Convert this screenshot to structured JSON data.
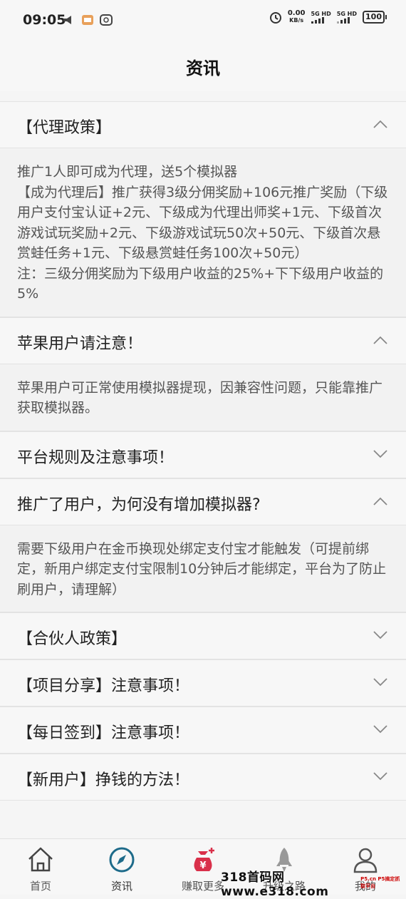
{
  "status_bar": {
    "time": "09:05",
    "net_speed_value": "0.00",
    "net_speed_unit": "KB/s",
    "sim1": "5G HD",
    "sim2": "5G HD",
    "battery": "100"
  },
  "header": {
    "title": "资讯"
  },
  "sections": [
    {
      "title": "【代理政策】",
      "expanded": true,
      "body": [
        "推广1人即可成为代理，送5个模拟器",
        "【成为代理后】推广获得3级分佣奖励+106元推广奖励（下级用户支付宝认证+2元、下级成为代理出师奖+1元、下级首次游戏试玩奖励+2元、下级游戏试玩50次+50元、下级首次悬赏蛙任务+1元、下级悬赏蛙任务100次+50元）",
        "注：三级分佣奖励为下级用户收益的25%+下下级用户收益的5%"
      ]
    },
    {
      "title": "苹果用户请注意！",
      "expanded": true,
      "body": [
        "苹果用户可正常使用模拟器提现，因兼容性问题，只能靠推广获取模拟器。"
      ]
    },
    {
      "title": "平台规则及注意事项！",
      "expanded": false
    },
    {
      "title": "推广了用户，为何没有增加模拟器?",
      "expanded": true,
      "body": [
        "需要下级用户在金币换现处绑定支付宝才能触发（可提前绑定，新用户绑定支付宝限制10分钟后才能绑定，平台为了防止刷用户，请理解）"
      ]
    },
    {
      "title": "【合伙人政策】",
      "expanded": false
    },
    {
      "title": "【项目分享】注意事项！",
      "expanded": false
    },
    {
      "title": "【每日签到】注意事项！",
      "expanded": false
    },
    {
      "title": "【新用户】挣钱的方法！",
      "expanded": false
    }
  ],
  "nav": {
    "items": [
      {
        "label": "首页",
        "icon": "home-icon",
        "active": false
      },
      {
        "label": "资讯",
        "icon": "compass-icon",
        "active": true
      },
      {
        "label": "赚取更多",
        "icon": "money-bag-icon",
        "active": false
      },
      {
        "label": "升级之路",
        "icon": "rocket-icon",
        "active": false
      },
      {
        "label": "我的",
        "icon": "user-icon",
        "active": false
      }
    ]
  },
  "watermark": {
    "site": "318首码网 www.e318.com",
    "sub": "P5.cn P5搞定抓取平台"
  },
  "colors": {
    "accent": "#1e6b8a",
    "money_red": "#d9304a",
    "text": "#333333",
    "bg": "#f5f5f5"
  }
}
